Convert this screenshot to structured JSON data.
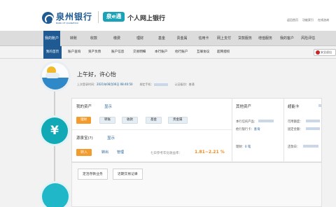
{
  "header": {
    "logo_cn": "泉州银行",
    "logo_en": "BANK OF QUANZHOU",
    "quan_label": "泉e通",
    "bank_name": "个人网上银行",
    "top_links": [
      "返回首页",
      "功能索引",
      "在线咨询"
    ]
  },
  "nav": {
    "items": [
      "我的账户",
      "转账",
      "收款",
      "缴费",
      "理财",
      "基金",
      "贵金属",
      "信用卡",
      "网上支付",
      "贷款服务",
      "增值服务",
      "我的客户",
      "风险评估"
    ]
  },
  "subnav": {
    "items": [
      "我的首页",
      "账户查询",
      "资产负债",
      "账户信息",
      "交易明细",
      "本行账户",
      "他行账户",
      "互联协议",
      "超网授权"
    ],
    "secure_label": "安全退出"
  },
  "greeting": {
    "text": "上午好，许心怡",
    "last_login_label": "上次登录时间：",
    "last_login_value": "2021年08月06日 08:40:50",
    "phone_label": "绑定手机：",
    "level_label": "认证级别：",
    "level_value": "普通"
  },
  "assets": {
    "title": "我的资产",
    "show_link": "显示",
    "tags": [
      "理财",
      "转账",
      "收款",
      "基金",
      "贵金属"
    ]
  },
  "quanbao": {
    "title": "源泉宝(?)",
    "show_link": "显示",
    "transfer_in": "转入",
    "transfer_out": "转出",
    "manage": "管理",
    "yield_label": "七日参考年化收益率：",
    "yield_value": "1.81~2.21 %"
  },
  "other_assets": {
    "title": "其他资产",
    "row1_label": "本行信托产品：",
    "row2_label": "他行银行卡：",
    "row2_link": "查询",
    "bottom_label": "理财：",
    "bottom_value": "0 笔"
  },
  "super_card": {
    "title": "超能卡",
    "row1_label": "可用额度：",
    "row2_label": "固定金额：",
    "row3_label": "还款日："
  },
  "tabs": [
    "定活存款业务",
    "近期交易记录"
  ]
}
